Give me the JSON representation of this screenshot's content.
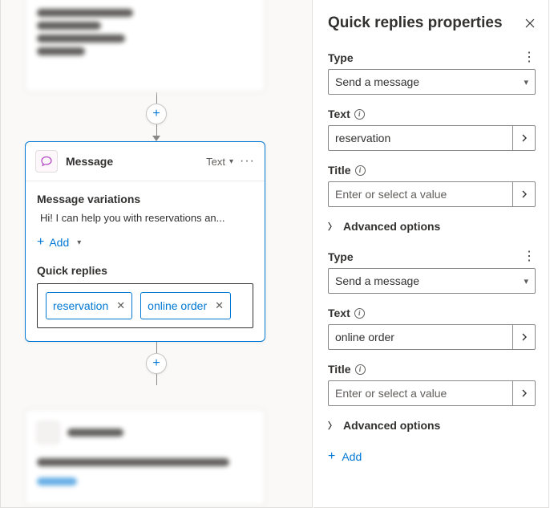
{
  "panel": {
    "title": "Quick replies properties",
    "add_label": "Add",
    "groups": [
      {
        "type_label": "Type",
        "type_value": "Send a message",
        "text_label": "Text",
        "text_value": "reservation",
        "title_label": "Title",
        "title_placeholder": "Enter or select a value",
        "advanced_label": "Advanced options"
      },
      {
        "type_label": "Type",
        "type_value": "Send a message",
        "text_label": "Text",
        "text_value": "online order",
        "title_label": "Title",
        "title_placeholder": "Enter or select a value",
        "advanced_label": "Advanced options"
      }
    ]
  },
  "message_node": {
    "header_title": "Message",
    "header_format": "Text",
    "variations_label": "Message variations",
    "variation_text": "Hi! I can help you with reservations an...",
    "add_label": "Add",
    "quick_replies_label": "Quick replies",
    "chips": [
      "reservation",
      "online order"
    ]
  }
}
